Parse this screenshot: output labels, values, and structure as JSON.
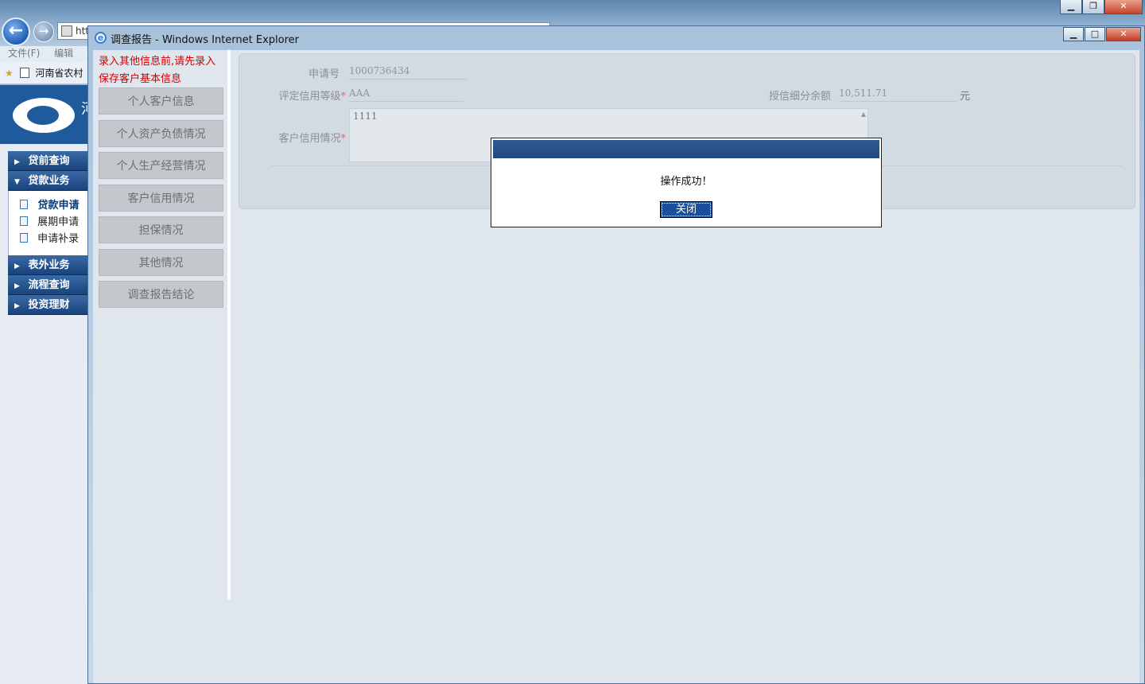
{
  "outer_window": {
    "address_prefix": "htt",
    "menu": [
      "文件(F)",
      "编辑(E)"
    ],
    "favorites_text": "河南省农村",
    "logo_text": "河"
  },
  "left_nav": {
    "sections": [
      {
        "label": "贷前查询",
        "expanded": false
      },
      {
        "label": "贷款业务",
        "expanded": true,
        "items": [
          "贷款申请",
          "展期申请",
          "申请补录"
        ],
        "active": "贷款申请"
      },
      {
        "label": "表外业务",
        "expanded": false
      },
      {
        "label": "流程查询",
        "expanded": false
      },
      {
        "label": "投资理财",
        "expanded": false
      }
    ]
  },
  "popup": {
    "title": "调查报告 - Windows Internet Explorer",
    "warning": "录入其他信息前,请先录入保存客户基本信息",
    "sidebar": [
      "个人客户信息",
      "个人资产负债情况",
      "个人生产经营情况",
      "客户信用情况",
      "担保情况",
      "其他情况",
      "调查报告结论"
    ],
    "form": {
      "application_no_label": "申请号",
      "application_no": "1000736434",
      "credit_rating_label": "评定信用等级",
      "credit_rating": "AAA",
      "credit_balance_label": "授信细分余额",
      "credit_balance": "10,511.71",
      "credit_balance_unit": "元",
      "credit_status_label": "客户信用情况",
      "credit_status": "1111",
      "required_mark": "*"
    },
    "dialog": {
      "message": "操作成功！",
      "close_label": "关闭"
    }
  },
  "colors": {
    "nav_blue": "#19437c",
    "warning_red": "#d40000",
    "dialog_bar": "#2f5b92",
    "dialog_button": "#1a4f9c"
  }
}
